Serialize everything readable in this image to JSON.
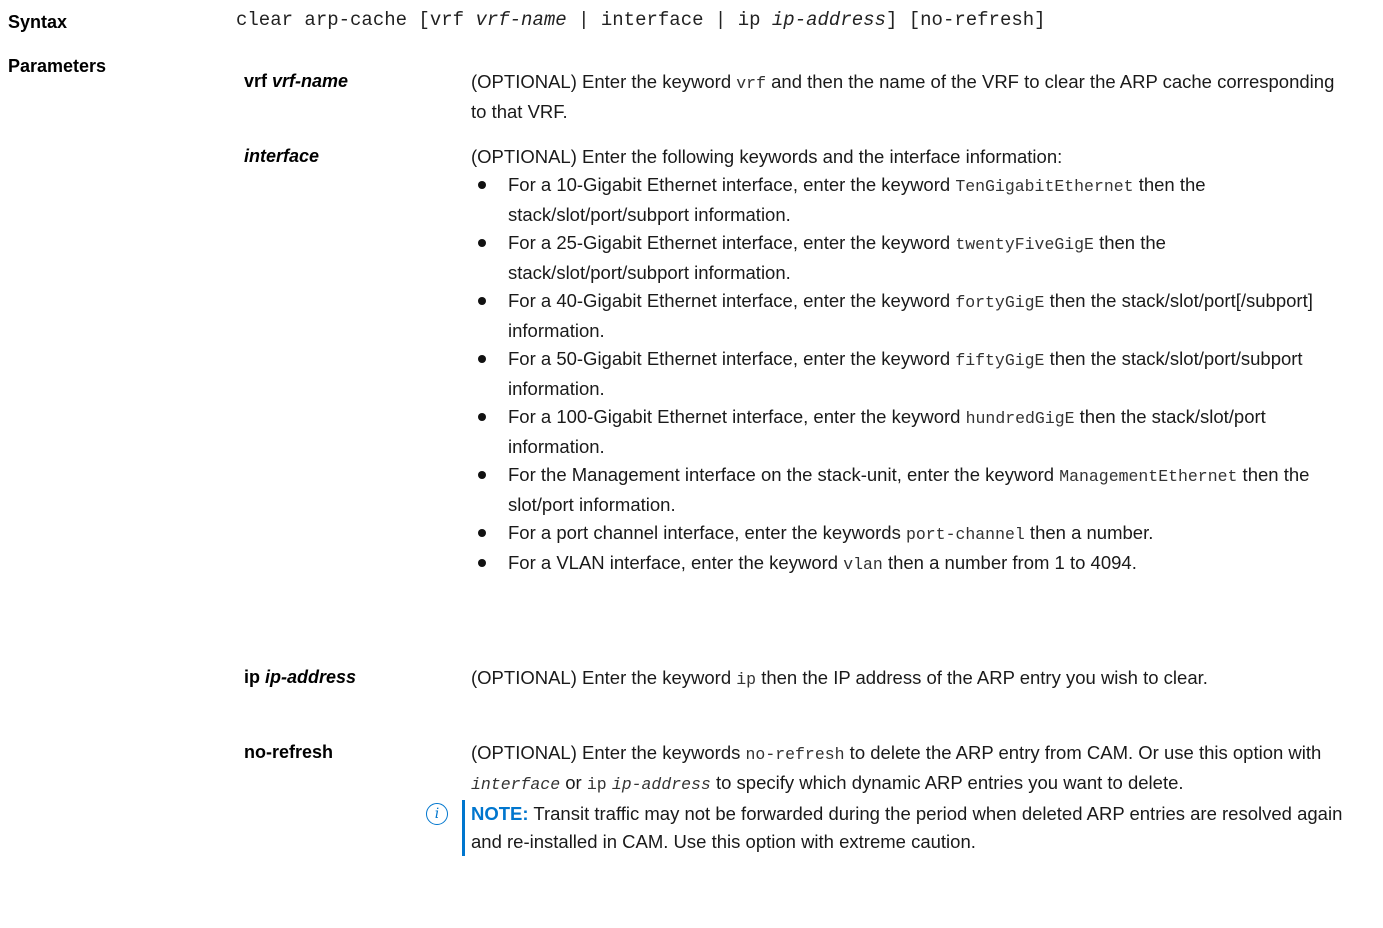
{
  "syntax": {
    "label": "Syntax",
    "parts": [
      "clear arp-cache [vrf ",
      "vrf-name",
      " | interface | ip ",
      "ip-address",
      "] [no-refresh]"
    ]
  },
  "parameters": {
    "label": "Parameters",
    "vrf": {
      "name_bold": "vrf",
      "name_italic": "vrf-name",
      "desc": [
        "(OPTIONAL) Enter the keyword ",
        "vrf",
        " and then the name of the VRF to clear the ARP cache corresponding to that VRF."
      ]
    },
    "interface": {
      "name": "interface",
      "intro": "(OPTIONAL) Enter the following keywords and the interface information:",
      "bullets": [
        [
          "For a 10-Gigabit Ethernet interface, enter the keyword ",
          "TenGigabitEthernet",
          " then the stack/slot/port/subport information."
        ],
        [
          "For a 25-Gigabit Ethernet interface, enter the keyword ",
          "twentyFiveGigE",
          " then the stack/slot/port/subport information."
        ],
        [
          "For a 40-Gigabit Ethernet interface, enter the keyword ",
          "fortyGigE",
          " then the stack/slot/port[/subport] information."
        ],
        [
          "For a 50-Gigabit Ethernet interface, enter the keyword ",
          "fiftyGigE",
          " then the stack/slot/port/subport information."
        ],
        [
          "For a 100-Gigabit Ethernet interface, enter the keyword ",
          "hundredGigE",
          " then the stack/slot/port information."
        ],
        [
          "For the Management interface on the stack-unit, enter the keyword ",
          "ManagementEthernet",
          " then the slot/port information."
        ],
        [
          "For a port channel interface, enter the keywords ",
          "port-channel",
          " then a number."
        ],
        [
          "For a VLAN interface, enter the keyword ",
          "vlan",
          " then a number from 1 to 4094."
        ]
      ]
    },
    "ip": {
      "name_bold": "ip",
      "name_italic": "ip-address",
      "desc": [
        "(OPTIONAL) Enter the keyword ",
        "ip",
        " then the IP address of the ARP entry you wish to clear."
      ]
    },
    "no_refresh": {
      "name": "no-refresh",
      "desc": [
        "(OPTIONAL) Enter the keywords ",
        "no-refresh",
        " to delete the ARP entry from CAM. Or use this option with ",
        "interface",
        " or ",
        "ip",
        " ",
        "ip-address",
        " to specify which dynamic ARP entries you want to delete."
      ],
      "note_label": "NOTE:",
      "note_text": " Transit traffic may not be forwarded during the period when deleted ARP entries are resolved again and re-installed in CAM. Use this option with extreme caution.",
      "note_icon": "info-icon"
    }
  },
  "colors": {
    "accent": "#0076ce",
    "text": "#1a1a1a"
  }
}
